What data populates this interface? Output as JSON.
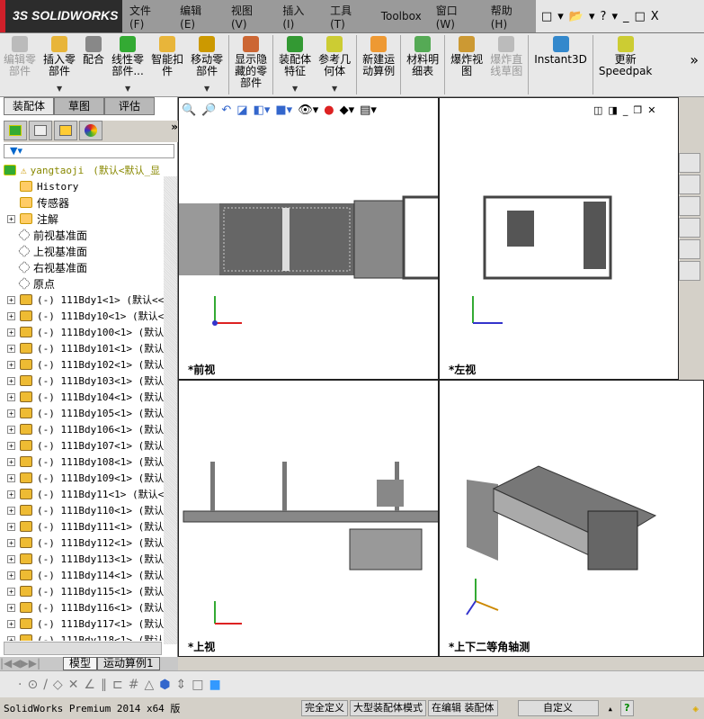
{
  "app": {
    "logo": "SOLIDWORKS"
  },
  "menu": [
    "文件(F)",
    "编辑(E)",
    "视图(V)",
    "插入(I)",
    "工具(T)",
    "Toolbox",
    "窗口(W)",
    "帮助(H)"
  ],
  "quick": [
    "□",
    "▾",
    "📂",
    "▾",
    "?",
    "▾",
    "_",
    "□",
    "X"
  ],
  "commands": [
    {
      "label": "编辑零\n部件",
      "disabled": true,
      "dropdown": false,
      "color": "#bbb"
    },
    {
      "label": "插入零\n部件",
      "disabled": false,
      "dropdown": true,
      "color": "#e8b53a"
    },
    {
      "label": "配合",
      "disabled": false,
      "dropdown": false,
      "color": "#888"
    },
    {
      "label": "线性零\n部件...",
      "disabled": false,
      "dropdown": true,
      "color": "#3a3"
    },
    {
      "label": "智能扣\n件",
      "disabled": false,
      "dropdown": false,
      "color": "#e8b53a"
    },
    {
      "label": "移动零\n部件",
      "disabled": false,
      "dropdown": true,
      "color": "#c90"
    },
    {
      "label": "显示隐\n藏的零\n部件",
      "disabled": false,
      "dropdown": false,
      "color": "#c63"
    },
    {
      "label": "装配体\n特征",
      "disabled": false,
      "dropdown": true,
      "color": "#393"
    },
    {
      "label": "参考几\n何体",
      "disabled": false,
      "dropdown": true,
      "color": "#cc3"
    },
    {
      "label": "新建运\n动算例",
      "disabled": false,
      "dropdown": false,
      "color": "#e93"
    },
    {
      "label": "材料明\n细表",
      "disabled": false,
      "dropdown": false,
      "color": "#5a5"
    },
    {
      "label": "爆炸视\n图",
      "disabled": false,
      "dropdown": false,
      "color": "#c93"
    },
    {
      "label": "爆炸直\n线草图",
      "disabled": true,
      "dropdown": false,
      "color": "#bbb"
    },
    {
      "label": "Instant3D",
      "disabled": false,
      "dropdown": false,
      "color": "#38c"
    },
    {
      "label": "更新\nSpeedpak",
      "disabled": false,
      "dropdown": false,
      "color": "#cc3"
    }
  ],
  "more": "»",
  "panel_tabs": [
    "装配体",
    "草图",
    "评估"
  ],
  "tree": {
    "root": "yangtaoji",
    "root_config": "(默认<默认_显",
    "items": [
      {
        "label": "History",
        "expand": false
      },
      {
        "label": "传感器",
        "expand": false
      },
      {
        "label": "注解",
        "expand": true
      },
      {
        "label": "前视基准面",
        "expand": false
      },
      {
        "label": "上视基准面",
        "expand": false
      },
      {
        "label": "右视基准面",
        "expand": false
      },
      {
        "label": "原点",
        "expand": false
      }
    ],
    "parts": [
      "(-) 111Bdy1<1> (默认<<默",
      "(-) 111Bdy10<1> (默认<<",
      "(-) 111Bdy100<1> (默认<",
      "(-) 111Bdy101<1> (默认<",
      "(-) 111Bdy102<1> (默认<",
      "(-) 111Bdy103<1> (默认<",
      "(-) 111Bdy104<1> (默认<",
      "(-) 111Bdy105<1> (默认<",
      "(-) 111Bdy106<1> (默认<",
      "(-) 111Bdy107<1> (默认<",
      "(-) 111Bdy108<1> (默认<",
      "(-) 111Bdy109<1> (默认<",
      "(-) 111Bdy11<1> (默认<<",
      "(-) 111Bdy110<1> (默认<",
      "(-) 111Bdy111<1> (默认<",
      "(-) 111Bdy112<1> (默认<",
      "(-) 111Bdy113<1> (默认<",
      "(-) 111Bdy114<1> (默认<",
      "(-) 111Bdy115<1> (默认<",
      "(-) 111Bdy116<1> (默认<",
      "(-) 111Bdy117<1> (默认<",
      "(-) 111Bdy118<1> (默认<"
    ]
  },
  "bottom_tabs": [
    "模型",
    "运动算例1"
  ],
  "viewports": {
    "front": "*前视",
    "left": "*左视",
    "top": "*上视",
    "iso": "*上下二等角轴测"
  },
  "status": {
    "product": "SolidWorks Premium 2014 x64 版",
    "defined": "完全定义",
    "mode": "大型装配体模式",
    "editing": "在编辑 装配体",
    "units": "自定义",
    "help": "?"
  }
}
